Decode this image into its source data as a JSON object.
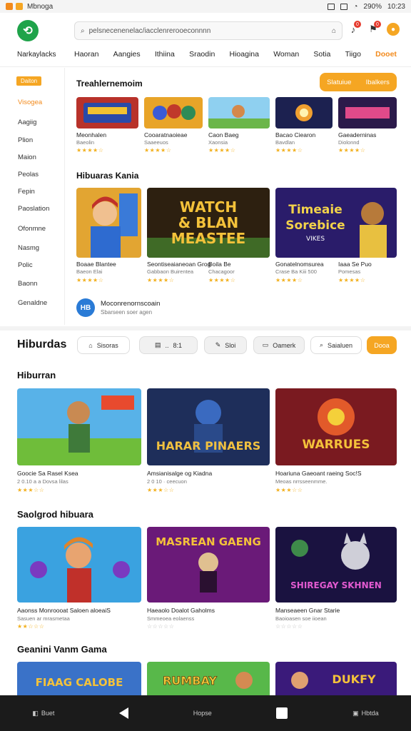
{
  "status_bar": {
    "app_label": "Mbnoga",
    "battery": "290%",
    "time": "10:23"
  },
  "header": {
    "logo_glyph": "⟲",
    "brand": "Narkaylacks",
    "search_placeholder": "pelsnecenenelac/iacclenrerooeconnnn",
    "badge_counts": [
      "0",
      "0"
    ],
    "nav": [
      "Haoran",
      "Aangies",
      "Ithiina",
      "Sraodin",
      "Hioagina",
      "Woman",
      "Sotia",
      "Tiigo",
      "Dooet"
    ]
  },
  "sidebar": {
    "badge": "Daiton",
    "items": [
      "Visogea",
      "Aagiig",
      "Plion",
      "Maion",
      "Peolas",
      "Fepin",
      "Paoslation",
      "Ofonmne",
      "Nasmg",
      "Polic",
      "Baonn",
      "Genaldne"
    ]
  },
  "top_panel": {
    "section1_title": "Treahlernemoim",
    "action_button": {
      "left": "Slatuiue",
      "right": "Ibalkers"
    },
    "row1": [
      {
        "title": "Meonhalen",
        "sub": "Baeolin",
        "stars": "★★★★☆"
      },
      {
        "title": "Cooaratnaoieae",
        "sub": "Saaeeuos",
        "stars": "★★★★☆"
      },
      {
        "title": "Caon Baeg",
        "sub": "Xaonsia",
        "stars": "★★★★☆"
      },
      {
        "title": "Bacao Ciearon",
        "sub": "Bavdlan",
        "stars": "★★★★☆"
      },
      {
        "title": "Gaeaderninas",
        "sub": "Diolonnd",
        "stars": "★★★★☆"
      }
    ],
    "section2_title": "Hibuaras Kania",
    "row2": [
      {
        "title": "Boaae Blantee",
        "sub": "Baeon Elai",
        "stars": "★★★★☆"
      },
      {
        "title": "Seontiseaianeoan Grog",
        "sub": "Gabbaon Buirentea",
        "stars": "★★★★☆"
      },
      {
        "title": "Boila Be",
        "sub": "Chacagoor",
        "stars": "★★★★☆"
      },
      {
        "title": "Gonatelnomsurea",
        "sub": "Crase Ba Kiii 500",
        "stars": "★★★★☆"
      },
      {
        "title": "Iaaa Se Puo",
        "sub": "Pomesas",
        "stars": "★★★★☆"
      }
    ],
    "art_text_1": [
      "WATCH",
      "& BLAN",
      "MEASTEE"
    ],
    "art_text_2": [
      "Timeaie",
      "Sorebice",
      "VIKES"
    ],
    "hb_icon_text": "HB",
    "hb_line1": "Moconrenornscoain",
    "hb_line2": "Sbarseen soer agen"
  },
  "filter_bar": {
    "title": "Hiburdas",
    "chips": [
      "Sisoras",
      "8:1",
      "Sloi",
      "Oamerk",
      "Saialuen",
      "Dooa"
    ],
    "chip_sep": "..",
    "chip_icons": [
      "⌂",
      "▤",
      "✎",
      "▭",
      "⌕"
    ]
  },
  "sections": [
    {
      "title": "Hiburran",
      "cards": [
        {
          "title": "Goocie Sa Rasel Ksea",
          "sub": "2 0.10 a a Dovsa lilas",
          "stars": "★★★☆☆"
        },
        {
          "title": "Amsianisalge og Kiadna",
          "sub": "2 0 10 · ceecuon",
          "stars": "★★★☆☆"
        },
        {
          "title": "Hoariuna Gaeoant raeing Soc!S",
          "sub": "Meoas nrrsseenmme.",
          "stars": "★★★☆☆"
        }
      ],
      "art": [
        "",
        "HARAR PINAERS",
        "WARRUES"
      ]
    },
    {
      "title": "Saolgrod hibuara",
      "cards": [
        {
          "title": "Aaonss Monroooat Saloen aloeaiS",
          "sub": "Sasuen ar mrasmetaa",
          "stars": "★★☆☆☆"
        },
        {
          "title": "Haeaolo Doalot Gaholms",
          "sub": "Smmeoea eolaenss",
          "stars": "☆☆☆☆☆"
        },
        {
          "title": "Manseaeen Gnar Starie",
          "sub": "Baoioasen soe iioean",
          "stars": "☆☆☆☆☆"
        }
      ],
      "art": [
        "",
        "MASREAN GAENG",
        "SHIREGAY SKHNEN"
      ]
    },
    {
      "title": "Geanini Vanm Gama",
      "art": [
        "FIAAG CALOBE",
        "RUMBAY",
        "DUKFY"
      ]
    }
  ],
  "bottom_nav": {
    "left_label": "Buet",
    "center_label": "Hopse",
    "right_label": "Hbtda",
    "left_icon_glyph": "◧",
    "right_icon_glyph": "▣"
  }
}
